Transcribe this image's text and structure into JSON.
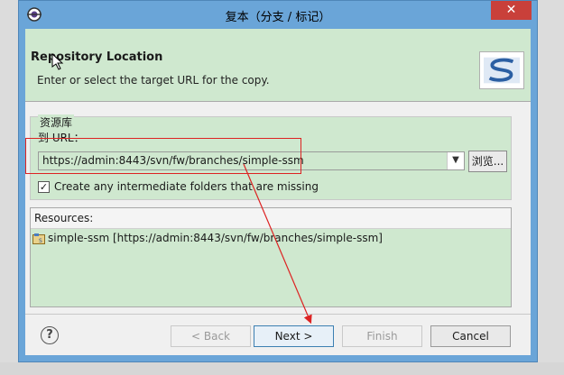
{
  "window": {
    "title": "复本（分支 / 标记）",
    "close_label": "✕"
  },
  "banner": {
    "title": "Repository Location",
    "description": "Enter or select the target URL for the copy."
  },
  "repo_group": {
    "label": "资源库",
    "url_label": "到 URL：",
    "url_value": "https://admin:8443/svn/fw/branches/simple-ssm",
    "browse_label": "浏览...",
    "checkbox_checked": true,
    "checkbox_label": "Create any intermediate folders that are missing"
  },
  "resources": {
    "header": "Resources:",
    "items": [
      {
        "label": "simple-ssm [https://admin:8443/svn/fw/branches/simple-ssm]",
        "icon": "svn-project-icon"
      }
    ]
  },
  "footer": {
    "help_label": "?",
    "back_label": "< Back",
    "next_label": "Next >",
    "finish_label": "Finish",
    "cancel_label": "Cancel"
  },
  "colors": {
    "accent_green": "#cfe8cf",
    "titlebar_blue": "#6aa5d8",
    "annotation_red": "#dd2222",
    "close_red": "#c9403a"
  }
}
